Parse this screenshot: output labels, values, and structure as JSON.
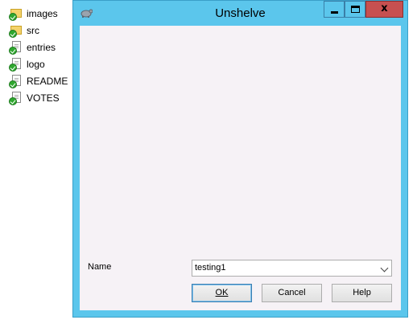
{
  "files": [
    {
      "name": "images",
      "icon": "folder-checked-icon"
    },
    {
      "name": "src",
      "icon": "folder-checked-icon"
    },
    {
      "name": "entries",
      "icon": "document-checked-icon"
    },
    {
      "name": "logo",
      "icon": "document-checked-icon"
    },
    {
      "name": "README",
      "icon": "document-checked-icon"
    },
    {
      "name": "VOTES",
      "icon": "document-checked-icon"
    }
  ],
  "dialog": {
    "title": "Unshelve",
    "title_bar_color": "#5bc6ec",
    "close_button_color": "#c75050",
    "close_glyph": "x",
    "name_label": "Name",
    "name_value": "testing1",
    "buttons": {
      "ok": "OK",
      "cancel": "Cancel",
      "help": "Help"
    }
  }
}
